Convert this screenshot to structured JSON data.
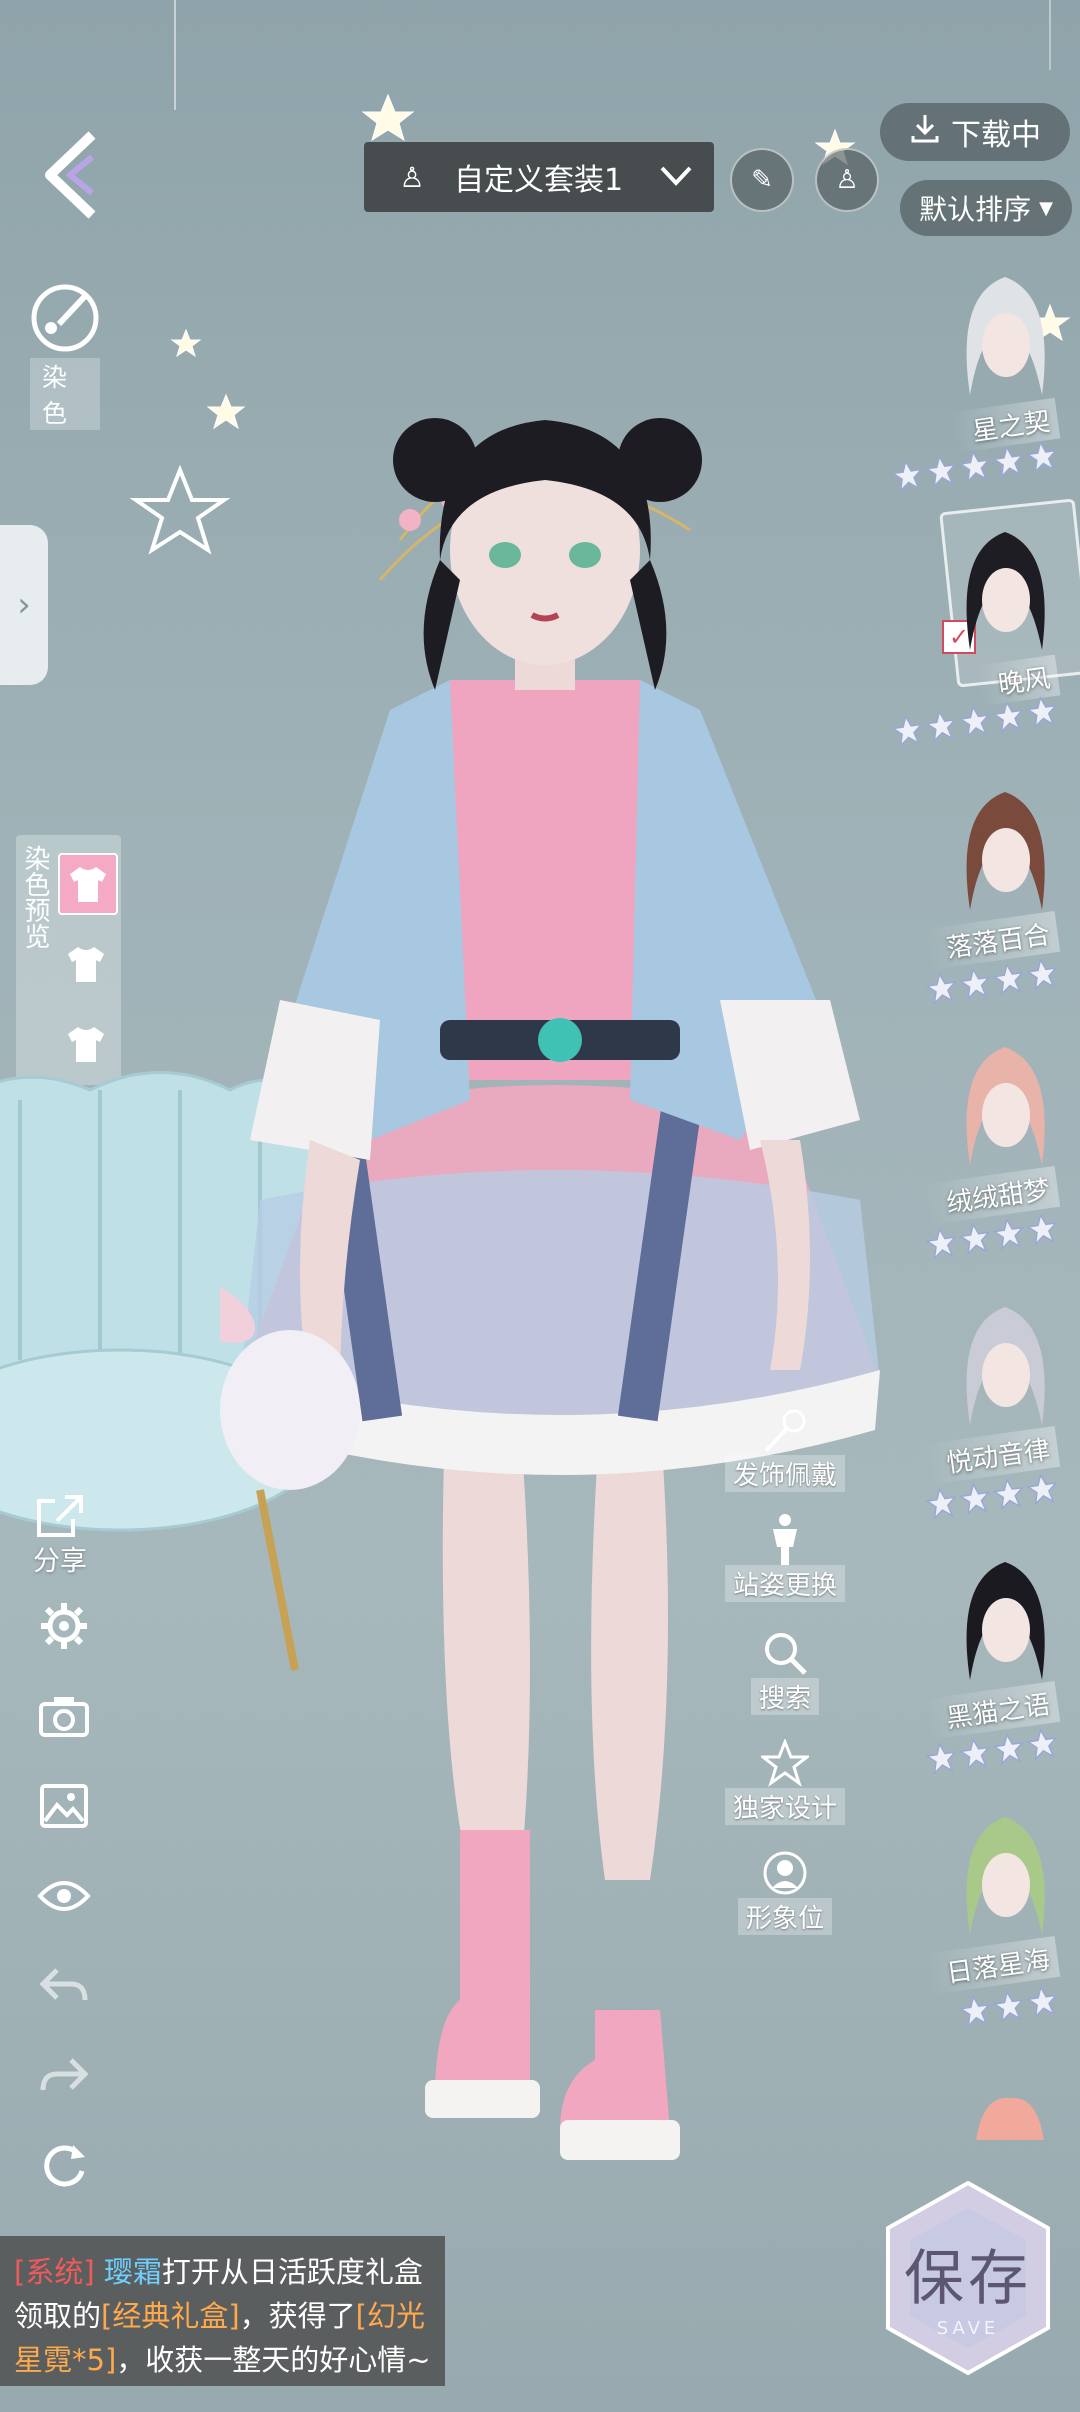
{
  "top_bar": {
    "outfit_name": "自定义套装1",
    "download_label": "下载中",
    "sort_label": "默认排序"
  },
  "left_tools": {
    "dye_label": "染色",
    "dye_preview_label": "染色预览",
    "share_label": "分享"
  },
  "mid_menu": [
    {
      "label": "发饰佩戴",
      "icon": "hair-accessory-icon"
    },
    {
      "label": "站姿更换",
      "icon": "pose-icon"
    },
    {
      "label": "搜索",
      "icon": "search-icon"
    },
    {
      "label": "独家设计",
      "icon": "star-outline-icon"
    },
    {
      "label": "形象位",
      "icon": "portrait-icon"
    }
  ],
  "hair_list": [
    {
      "name": "星之契",
      "stars": 5,
      "color": "#dfe3e6",
      "selected": false
    },
    {
      "name": "晚风",
      "stars": 5,
      "color": "#1f1d24",
      "selected": true
    },
    {
      "name": "落落百合",
      "stars": 4,
      "color": "#7a4a3c",
      "selected": false
    },
    {
      "name": "绒绒甜梦",
      "stars": 4,
      "color": "#e8b3a8",
      "selected": false
    },
    {
      "name": "悦动音律",
      "stars": 4,
      "color": "#c9ccd6",
      "selected": false
    },
    {
      "name": "黑猫之语",
      "stars": 4,
      "color": "#1b1a20",
      "selected": false
    },
    {
      "name": "日落星海",
      "stars": 3,
      "color": "#a9c98a",
      "selected": false
    }
  ],
  "save_button": {
    "label": "保存",
    "sub_label": "SAVE"
  },
  "system_message": {
    "tag": "[系统]",
    "player": "璎霜",
    "text1": "打开从日活跃度礼盒",
    "text2": "领取的",
    "item": "[经典礼盒]",
    "text3": "，获得了",
    "reward": "[幻光星霓*5]",
    "text4": "，收获一整天的好心情~"
  },
  "colors": {
    "background": "#9fb2b7",
    "accent_pink": "#f4a9c4",
    "sys_tag": "#ef5a5a",
    "player_name": "#6fd0ff",
    "item_name": "#ffa94d"
  }
}
